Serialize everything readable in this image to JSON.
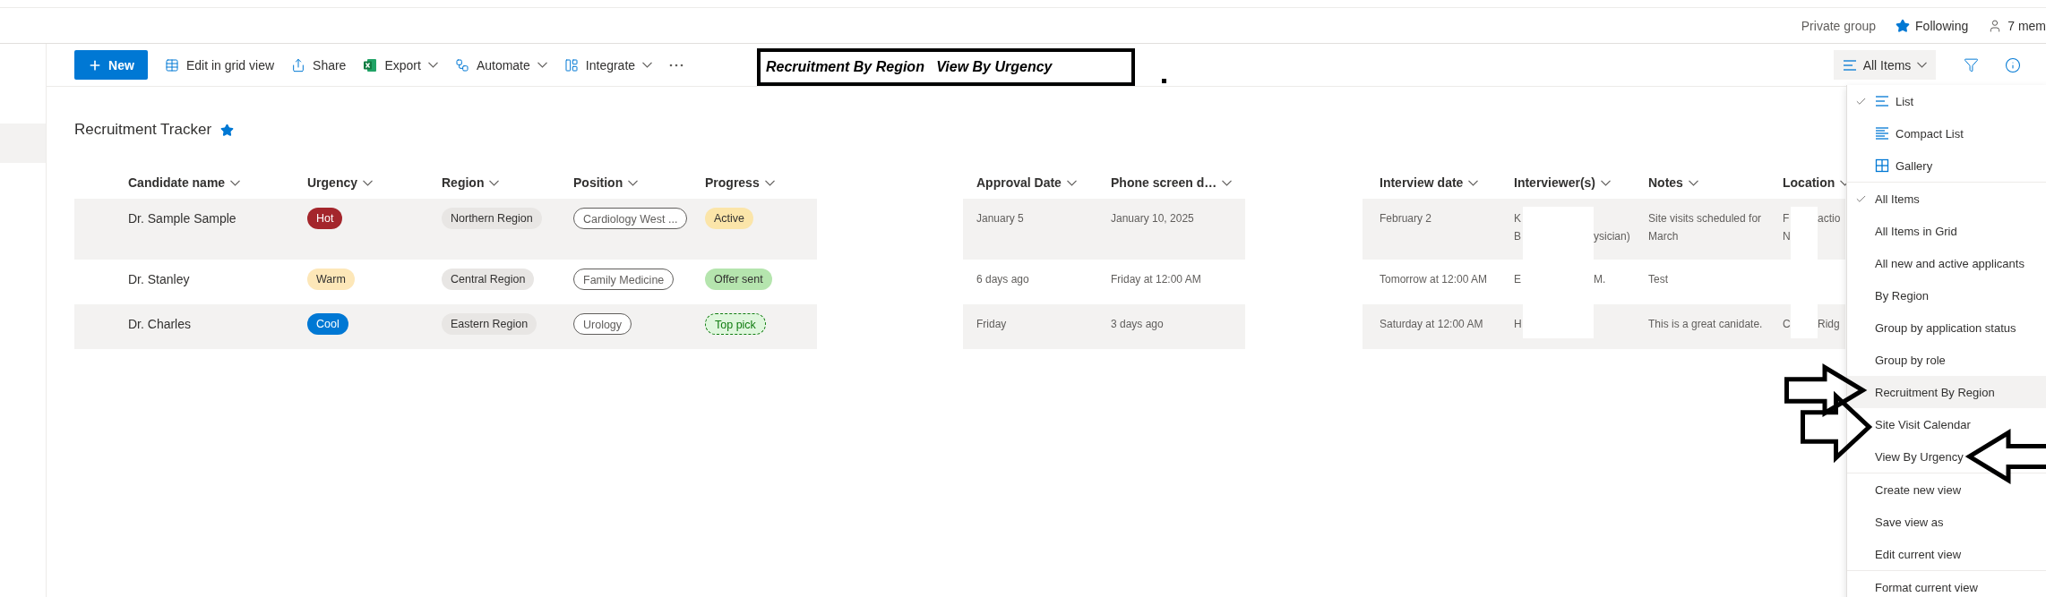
{
  "top_bar": {
    "privacy": "Private group",
    "follow": {
      "label": "Following",
      "on": true
    },
    "members": "7 mem"
  },
  "sidebar": {
    "items": [
      {
        "selected": true
      }
    ]
  },
  "toolbar": {
    "items": [
      {
        "kind": "new",
        "label": "New",
        "menu": false
      },
      {
        "kind": "grid",
        "label": "Edit in grid view",
        "menu": false
      },
      {
        "kind": "share",
        "label": "Share",
        "menu": false
      },
      {
        "kind": "excel",
        "label": "Export",
        "menu": true
      },
      {
        "kind": "flow",
        "label": "Automate",
        "menu": true
      },
      {
        "kind": "panel",
        "label": "Integrate",
        "menu": true
      },
      {
        "kind": "more",
        "menu": false
      }
    ],
    "view_button": {
      "label": "All Items",
      "expanded": true
    }
  },
  "annotation": {
    "text": "Recruitment By Region   View By Urgency",
    "arrows": [
      {
        "kind": "right"
      },
      {
        "kind": "right"
      },
      {
        "kind": "left"
      }
    ]
  },
  "list_title": {
    "text": "Recruitment Tracker",
    "favorite": true
  },
  "table": {
    "columns": [
      {
        "kind": "field",
        "label": "Candidate name"
      },
      {
        "kind": "field",
        "label": "Urgency"
      },
      {
        "kind": "field",
        "label": "Region"
      },
      {
        "kind": "field",
        "label": "Position"
      },
      {
        "kind": "field",
        "label": "Progress"
      },
      {
        "kind": "redacted"
      },
      {
        "kind": "field",
        "label": "Approval Date"
      },
      {
        "kind": "field",
        "label": "Phone screen d…"
      },
      {
        "kind": "redacted"
      },
      {
        "kind": "field",
        "label": "Interview date"
      },
      {
        "kind": "masked",
        "label": "Interviewer(s)"
      },
      {
        "kind": "field",
        "label": "Notes"
      },
      {
        "kind": "masked",
        "label": "Location"
      }
    ],
    "rows": [
      {
        "cells": [
          {
            "kind": "name",
            "text": "Dr. Sample Sample"
          },
          {
            "kind": "tag",
            "text": "Hot",
            "color": "#a4262c"
          },
          {
            "kind": "tag",
            "text": "Northern Region",
            "color": "#e8e6e4"
          },
          {
            "kind": "outline",
            "text": "Cardiology West ..."
          },
          {
            "kind": "tag",
            "text": "Active",
            "color": "#fbe5a9"
          },
          {
            "kind": "redacted"
          },
          {
            "kind": "text",
            "text": "January 5"
          },
          {
            "kind": "text",
            "text": "January 10, 2025"
          },
          {
            "kind": "redacted"
          },
          {
            "kind": "text",
            "text": "February 2"
          },
          {
            "kind": "fragments",
            "lines": [
              [
                "K"
              ],
              [
                "B",
                "ysician)"
              ]
            ]
          },
          {
            "kind": "text",
            "text": "Site visits scheduled for March"
          },
          {
            "kind": "fragments",
            "lines": [
              [
                "F",
                "actio"
              ],
              [
                "N"
              ]
            ]
          }
        ]
      },
      {
        "cells": [
          {
            "kind": "name",
            "text": "Dr. Stanley"
          },
          {
            "kind": "tag",
            "text": "Warm",
            "color": "#fde7b8"
          },
          {
            "kind": "tag",
            "text": "Central Region",
            "color": "#e8e6e4"
          },
          {
            "kind": "outline",
            "text": "Family Medicine"
          },
          {
            "kind": "tag",
            "text": "Offer sent",
            "color": "#b5e5ae"
          },
          {
            "kind": "redacted"
          },
          {
            "kind": "text",
            "text": "6 days ago"
          },
          {
            "kind": "text",
            "text": "Friday at 12:00 AM"
          },
          {
            "kind": "redacted"
          },
          {
            "kind": "text",
            "text": "Tomorrow at 12:00 AM"
          },
          {
            "kind": "fragments",
            "lines": [
              [
                "E",
                "M."
              ]
            ]
          },
          {
            "kind": "text",
            "text": "Test"
          },
          {
            "kind": "empty"
          }
        ]
      },
      {
        "cells": [
          {
            "kind": "name",
            "text": "Dr. Charles"
          },
          {
            "kind": "tag",
            "text": "Cool",
            "color": "#0078d4"
          },
          {
            "kind": "tag",
            "text": "Eastern Region",
            "color": "#e8e6e4"
          },
          {
            "kind": "outline",
            "text": "Urology"
          },
          {
            "kind": "dashed",
            "text": "Top pick",
            "color": "#107c10"
          },
          {
            "kind": "redacted"
          },
          {
            "kind": "text",
            "text": "Friday"
          },
          {
            "kind": "text",
            "text": "3 days ago"
          },
          {
            "kind": "redacted"
          },
          {
            "kind": "text",
            "text": "Saturday at 12:00 AM"
          },
          {
            "kind": "fragments",
            "lines": [
              [
                "H"
              ]
            ]
          },
          {
            "kind": "text",
            "text": "This is a great canidate."
          },
          {
            "kind": "fragments",
            "lines": [
              [
                "C",
                "Ridg"
              ]
            ]
          }
        ]
      }
    ]
  },
  "view_menu": {
    "sections": [
      {
        "items": [
          {
            "label": "List",
            "kind": "list",
            "selected": true,
            "hovered": false
          },
          {
            "label": "Compact List",
            "kind": "compact",
            "selected": false,
            "hovered": false
          },
          {
            "label": "Gallery",
            "kind": "gallery",
            "selected": false,
            "hovered": false
          }
        ]
      },
      {
        "items": [
          {
            "label": "All Items",
            "kind": "plain",
            "selected": true,
            "hovered": false
          },
          {
            "label": "All Items in Grid",
            "kind": "plain",
            "selected": false,
            "hovered": false
          },
          {
            "label": "All new and active applicants",
            "kind": "plain",
            "selected": false,
            "hovered": false
          },
          {
            "label": "By Region",
            "kind": "plain",
            "selected": false,
            "hovered": false
          },
          {
            "label": "Group by application status",
            "kind": "plain",
            "selected": false,
            "hovered": false
          },
          {
            "label": "Group by role",
            "kind": "plain",
            "selected": false,
            "hovered": false
          },
          {
            "label": "Recruitment By Region",
            "kind": "plain",
            "selected": false,
            "hovered": true
          },
          {
            "label": "Site Visit Calendar",
            "kind": "plain",
            "selected": false,
            "hovered": false
          },
          {
            "label": "View By Urgency",
            "kind": "plain",
            "selected": false,
            "hovered": false
          }
        ]
      },
      {
        "items": [
          {
            "label": "Create new view",
            "kind": "plain",
            "hovered": false
          },
          {
            "label": "Save view as",
            "kind": "plain",
            "hovered": false
          },
          {
            "label": "Edit current view",
            "kind": "plain",
            "hovered": false
          }
        ]
      },
      {
        "items": [
          {
            "label": "Format current view",
            "kind": "plain",
            "hovered": false
          }
        ]
      }
    ]
  }
}
